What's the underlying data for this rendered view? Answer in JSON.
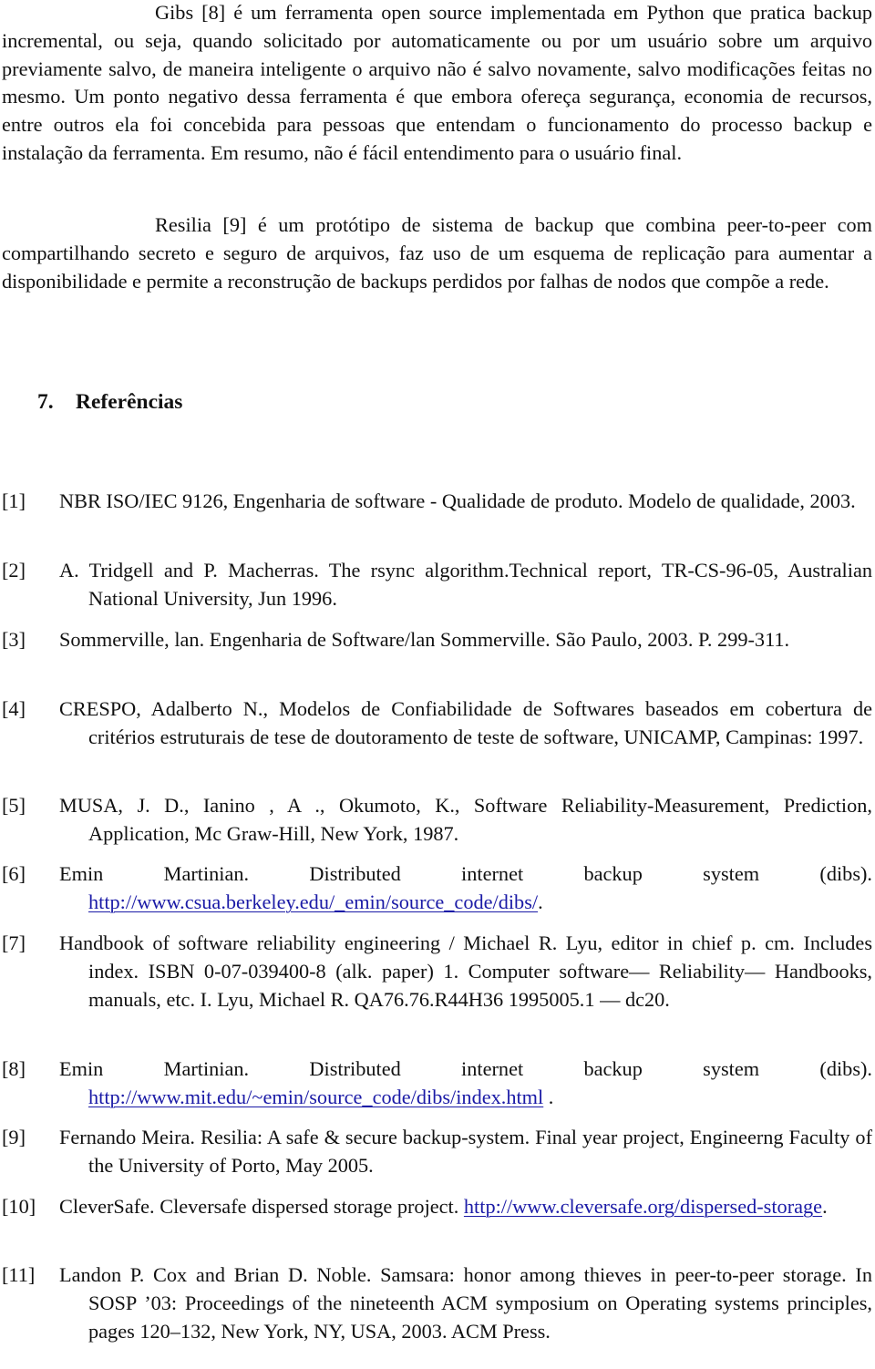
{
  "paragraphs": [
    "Gibs [8] é um ferramenta open source implementada em Python que pratica backup incremental, ou seja, quando solicitado por automaticamente ou por um usuário sobre um arquivo previamente salvo, de maneira inteligente o arquivo não é salvo novamente, salvo modificações feitas no mesmo. Um ponto negativo dessa ferramenta é que embora ofereça segurança, economia de recursos, entre outros ela foi concebida para pessoas que entendam o funcionamento do processo backup e instalação da ferramenta. Em resumo, não é fácil entendimento para o usuário final.",
    "Resilia [9] é um protótipo de sistema de backup que combina peer-to-peer com compartilhando secreto e seguro de arquivos, faz uso de um esquema de replicação para aumentar a disponibilidade e permite a reconstrução de backups perdidos por falhas de nodos que compõe a rede."
  ],
  "section": {
    "number": "7.",
    "title": "Referências"
  },
  "references": [
    {
      "label": "[1]",
      "text": "NBR ISO/IEC 9126, Engenharia de software - Qualidade de produto. Modelo de qualidade, 2003.",
      "link": "",
      "after": ""
    },
    {
      "label": "[2]",
      "text": "A. Tridgell and P. Macherras. The rsync algorithm.Technical report, TR-CS-96-05, Australian National University, Jun 1996.",
      "link": "",
      "after": ""
    },
    {
      "label": "[3]",
      "text": "Sommerville, lan. Engenharia de Software/lan Sommerville. São Paulo, 2003. P. 299-311.",
      "link": "",
      "after": ""
    },
    {
      "label": "[4]",
      "text": "CRESPO, Adalberto N., Modelos de Confiabilidade de Softwares baseados em cobertura de critérios estruturais de tese de doutoramento de teste de software, UNICAMP, Campinas: 1997.",
      "link": "",
      "after": ""
    },
    {
      "label": "[5]",
      "text": "MUSA, J. D., Ianino , A ., Okumoto, K., Software Reliability-Measurement, Prediction, Application, Mc Graw-Hill, New York, 1987.",
      "link": "",
      "after": ""
    },
    {
      "label": "[6]",
      "text": "Emin Martinian. Distributed internet backup system (dibs). ",
      "link": "http://www.csua.berkeley.edu/_emin/source_code/dibs/",
      "after": "."
    },
    {
      "label": "[7]",
      "text": "Handbook of software reliability engineering / Michael R. Lyu, editor in chief p. cm. Includes index. ISBN 0-07-039400-8 (alk. paper) 1. Computer software— Reliability— Handbooks, manuals, etc. I. Lyu, Michael R. QA76.76.R44H36 1995005.1 — dc20.",
      "link": "",
      "after": ""
    },
    {
      "label": "[8]",
      "text": "Emin Martinian. Distributed internet backup system (dibs). ",
      "link": "http://www.mit.edu/~emin/source_code/dibs/index.html",
      "after": " ."
    },
    {
      "label": "[9]",
      "text": "Fernando Meira. Resilia: A safe & secure backup-system. Final year project, Engineerng Faculty of the University of Porto, May 2005.",
      "link": "",
      "after": ""
    },
    {
      "label": "[10]",
      "text": "CleverSafe. Cleversafe dispersed storage project. ",
      "link": "http://www.cleversafe.org/dispersed-storage",
      "after": "."
    },
    {
      "label": "[11]",
      "text": "Landon P. Cox and Brian D. Noble. Samsara: honor among thieves in peer-to-peer storage. In SOSP ’03: Proceedings of the nineteenth ACM symposium on Operating systems principles, pages 120–132, New York, NY, USA, 2003. ACM Press.",
      "link": "",
      "after": ""
    }
  ],
  "colors": {
    "text": "#111111",
    "link": "#1a1aa6",
    "background": "#ffffff"
  }
}
